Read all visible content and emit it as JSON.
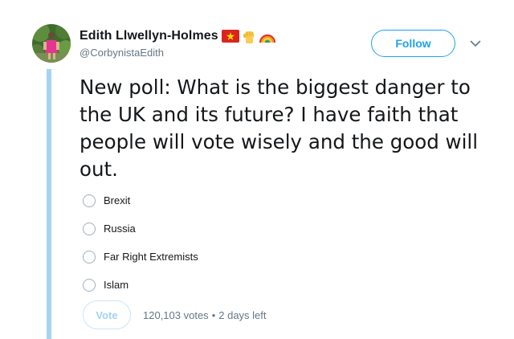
{
  "author": {
    "display_name": "Edith Llwellyn-Holmes",
    "handle": "@CorbynistaEdith",
    "name_emojis": [
      "vietnam-flag-emoji",
      "raised-fist-emoji",
      "rainbow-emoji"
    ]
  },
  "follow_label": "Follow",
  "tweet_text": "New poll: What is the biggest danger to the UK and its future? I have faith that people will vote wisely and the good will out.",
  "poll": {
    "options": [
      {
        "label": "Brexit"
      },
      {
        "label": "Russia"
      },
      {
        "label": "Far Right Extremists"
      },
      {
        "label": "Islam"
      }
    ],
    "vote_label": "Vote",
    "votes": "120,103 votes",
    "separator": "•",
    "time_left": "2 days left"
  },
  "colors": {
    "accent": "#1da1f2",
    "thread_line": "#a5d4f2",
    "muted_text": "#657786",
    "radio_border": "#a1afba"
  }
}
